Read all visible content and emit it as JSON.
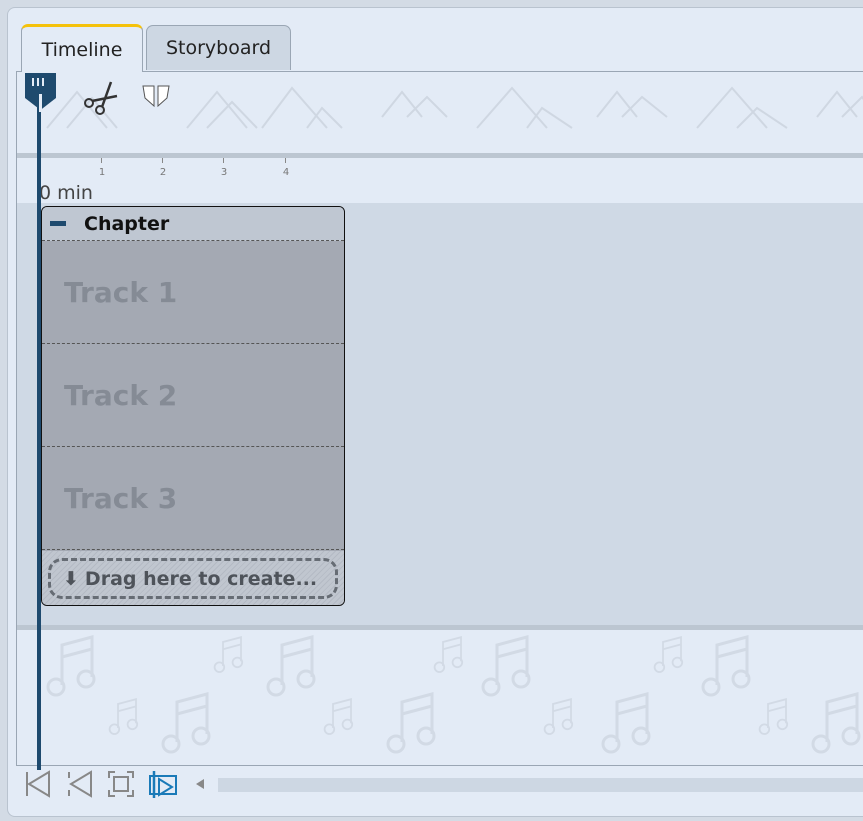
{
  "tabs": [
    {
      "label": "Timeline",
      "active": true
    },
    {
      "label": "Storyboard",
      "active": false
    }
  ],
  "toolbar": {
    "icons": [
      "playhead-icon",
      "scissors-icon",
      "split-marker-icon"
    ]
  },
  "ruler": {
    "ticks": [
      "1",
      "2",
      "3",
      "4"
    ],
    "start_label": "0 min"
  },
  "chapter": {
    "title": "Chapter",
    "tracks": [
      "Track 1",
      "Track 2",
      "Track 3"
    ],
    "drop_label": "Drag here to create..."
  },
  "bottom": {
    "icons": [
      "go-start-icon",
      "previous-icon",
      "fit-icon",
      "follow-playback-icon"
    ]
  },
  "colors": {
    "accent": "#f5c20b",
    "playhead": "#1e4a6e",
    "active_icon": "#1a7ab8"
  }
}
